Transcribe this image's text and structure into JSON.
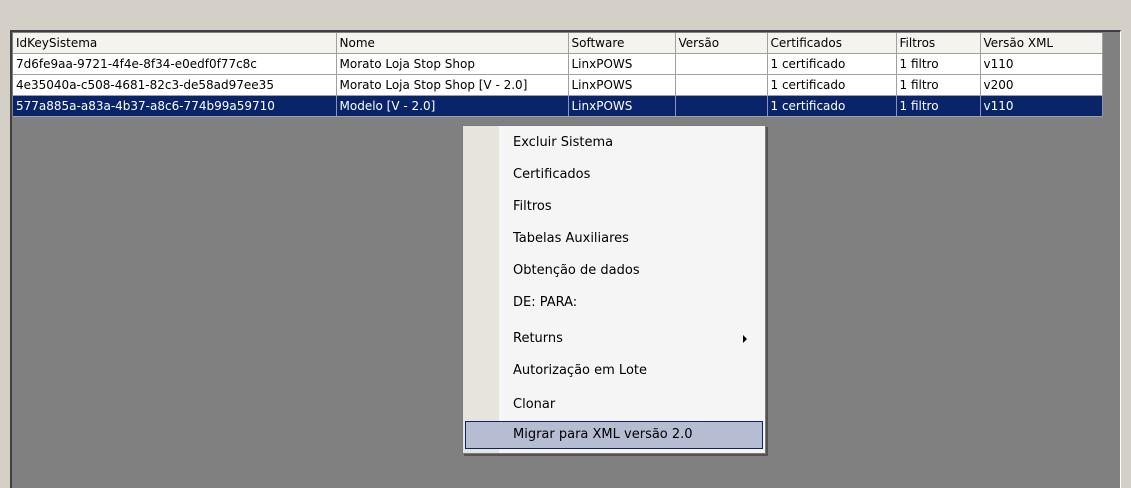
{
  "grid": {
    "columns": [
      "IdKeySistema",
      "Nome",
      "Software",
      "Versão",
      "Certificados",
      "Filtros",
      "Versão XML"
    ],
    "rows": [
      {
        "id": "7d6fe9aa-9721-4f4e-8f34-e0edf0f77c8c",
        "nome": "Morato Loja Stop Shop",
        "software": "LinxPOWS",
        "versao": "",
        "certificados": "1 certificado",
        "filtros": "1 filtro",
        "versao_xml": "v110"
      },
      {
        "id": "4e35040a-c508-4681-82c3-de58ad97ee35",
        "nome": "Morato Loja Stop Shop [V - 2.0]",
        "software": "LinxPOWS",
        "versao": "",
        "certificados": "1 certificado",
        "filtros": "1 filtro",
        "versao_xml": "v200"
      },
      {
        "id": "577a885a-a83a-4b37-a8c6-774b99a59710",
        "nome": "Modelo  [V - 2.0]",
        "software": "LinxPOWS",
        "versao": "",
        "certificados": "1 certificado",
        "filtros": "1 filtro",
        "versao_xml": "v110",
        "selected": true
      }
    ]
  },
  "context_menu": {
    "items": [
      "Excluir Sistema",
      "Certificados",
      "Filtros",
      "Tabelas Auxiliares",
      "Obtenção de dados",
      "DE: PARA:",
      "Returns",
      "Autorização em Lote",
      "Clonar",
      "Migrar para XML versão 2.0"
    ],
    "submenu_item": "Returns",
    "highlighted_item": "Migrar para XML versão 2.0"
  },
  "colors": {
    "selection": "#0a246a",
    "menu_highlight": "#b6bdd2",
    "grid_background": "#808080",
    "window_background": "#d4d0c8"
  }
}
